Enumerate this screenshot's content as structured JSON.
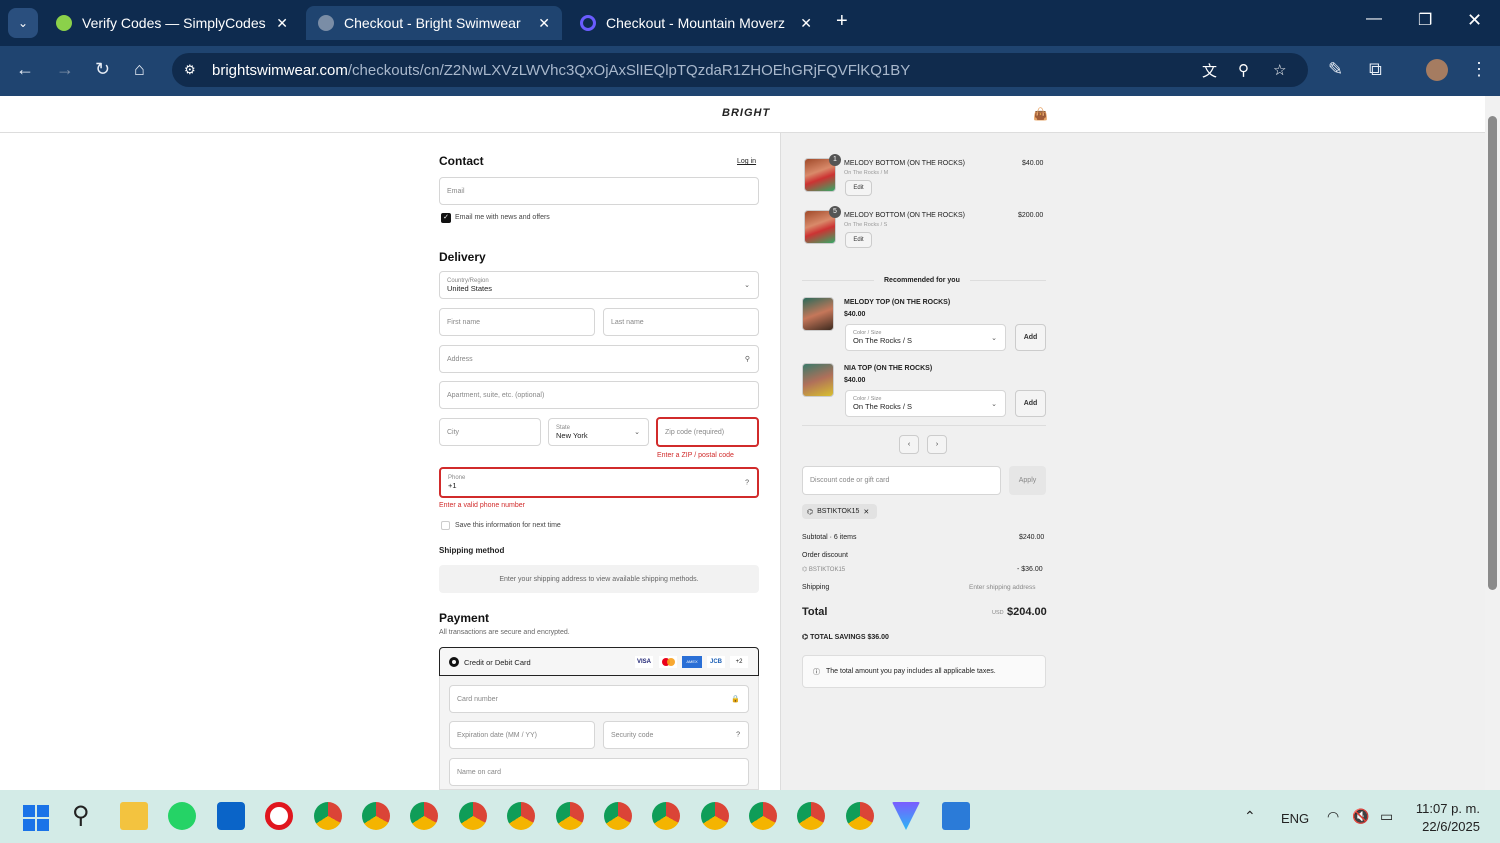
{
  "browser": {
    "tabs": [
      {
        "label": "Verify Codes — SimplyCodes",
        "active": false
      },
      {
        "label": "Checkout - Bright Swimwear",
        "active": true
      },
      {
        "label": "Checkout - Mountain Moverz",
        "active": false
      }
    ],
    "url_domain": "brightswimwear.com",
    "url_path": "/checkouts/cn/Z2NwLXVzLWVhc3QxOjAxSlIEQlpTQzdaR1ZHOEhGRjFQVFlKQ1BY"
  },
  "header": {
    "logo": "BRIGHT"
  },
  "contact": {
    "title": "Contact",
    "login": "Log in",
    "email_placeholder": "Email",
    "newsletter_label": "Email me with news and offers",
    "newsletter_checked": true
  },
  "delivery": {
    "title": "Delivery",
    "country_label": "Country/Region",
    "country": "United States",
    "first_name": "First name",
    "last_name": "Last name",
    "address": "Address",
    "apartment": "Apartment, suite, etc. (optional)",
    "city": "City",
    "state_label": "State",
    "state": "New York",
    "zip": "Zip code (required)",
    "zip_error": "Enter a ZIP / postal code",
    "phone_label": "Phone",
    "phone_value": "+1",
    "phone_error": "Enter a valid phone number",
    "save_label": "Save this information for next time"
  },
  "shipping": {
    "title": "Shipping method",
    "message": "Enter your shipping address to view available shipping methods."
  },
  "payment": {
    "title": "Payment",
    "subtitle": "All transactions are secure and encrypted.",
    "method": "Credit or Debit Card",
    "cards": [
      "VISA",
      "MC",
      "AMEX",
      "JCB",
      "+2"
    ],
    "card_number": "Card number",
    "expiry": "Expiration date (MM / YY)",
    "security": "Security code",
    "name": "Name on card"
  },
  "cart": {
    "items": [
      {
        "name": "MELODY BOTTOM (ON THE ROCKS)",
        "variant": "On The Rocks / M",
        "qty": "1",
        "price": "$40.00",
        "edit": "Edit"
      },
      {
        "name": "MELODY BOTTOM (ON THE ROCKS)",
        "variant": "On The Rocks / S",
        "qty": "5",
        "price": "$200.00",
        "edit": "Edit"
      }
    ],
    "recommended_title": "Recommended for you",
    "recommended": [
      {
        "name": "MELODY TOP (ON THE ROCKS)",
        "price": "$40.00",
        "select_label": "Color / Size",
        "select_value": "On The Rocks / S",
        "add": "Add"
      },
      {
        "name": "NIA TOP (ON THE ROCKS)",
        "price": "$40.00",
        "select_label": "Color / Size",
        "select_value": "On The Rocks / S",
        "add": "Add"
      }
    ],
    "discount_placeholder": "Discount code or gift card",
    "apply": "Apply",
    "code": "BSTIKTOK15",
    "subtotal_label": "Subtotal · 6 items",
    "subtotal": "$240.00",
    "order_discount": "Order discount",
    "discount_code": "BSTIKTOK15",
    "discount_amount": "- $36.00",
    "shipping_label": "Shipping",
    "shipping_value": "Enter shipping address",
    "total_label": "Total",
    "currency": "USD",
    "total": "$204.00",
    "savings": "TOTAL SAVINGS  $36.00",
    "tax_note": "The total amount you pay includes all applicable taxes."
  },
  "taskbar": {
    "lang": "ENG",
    "time": "11:07 p. m.",
    "date": "22/6/2025"
  }
}
